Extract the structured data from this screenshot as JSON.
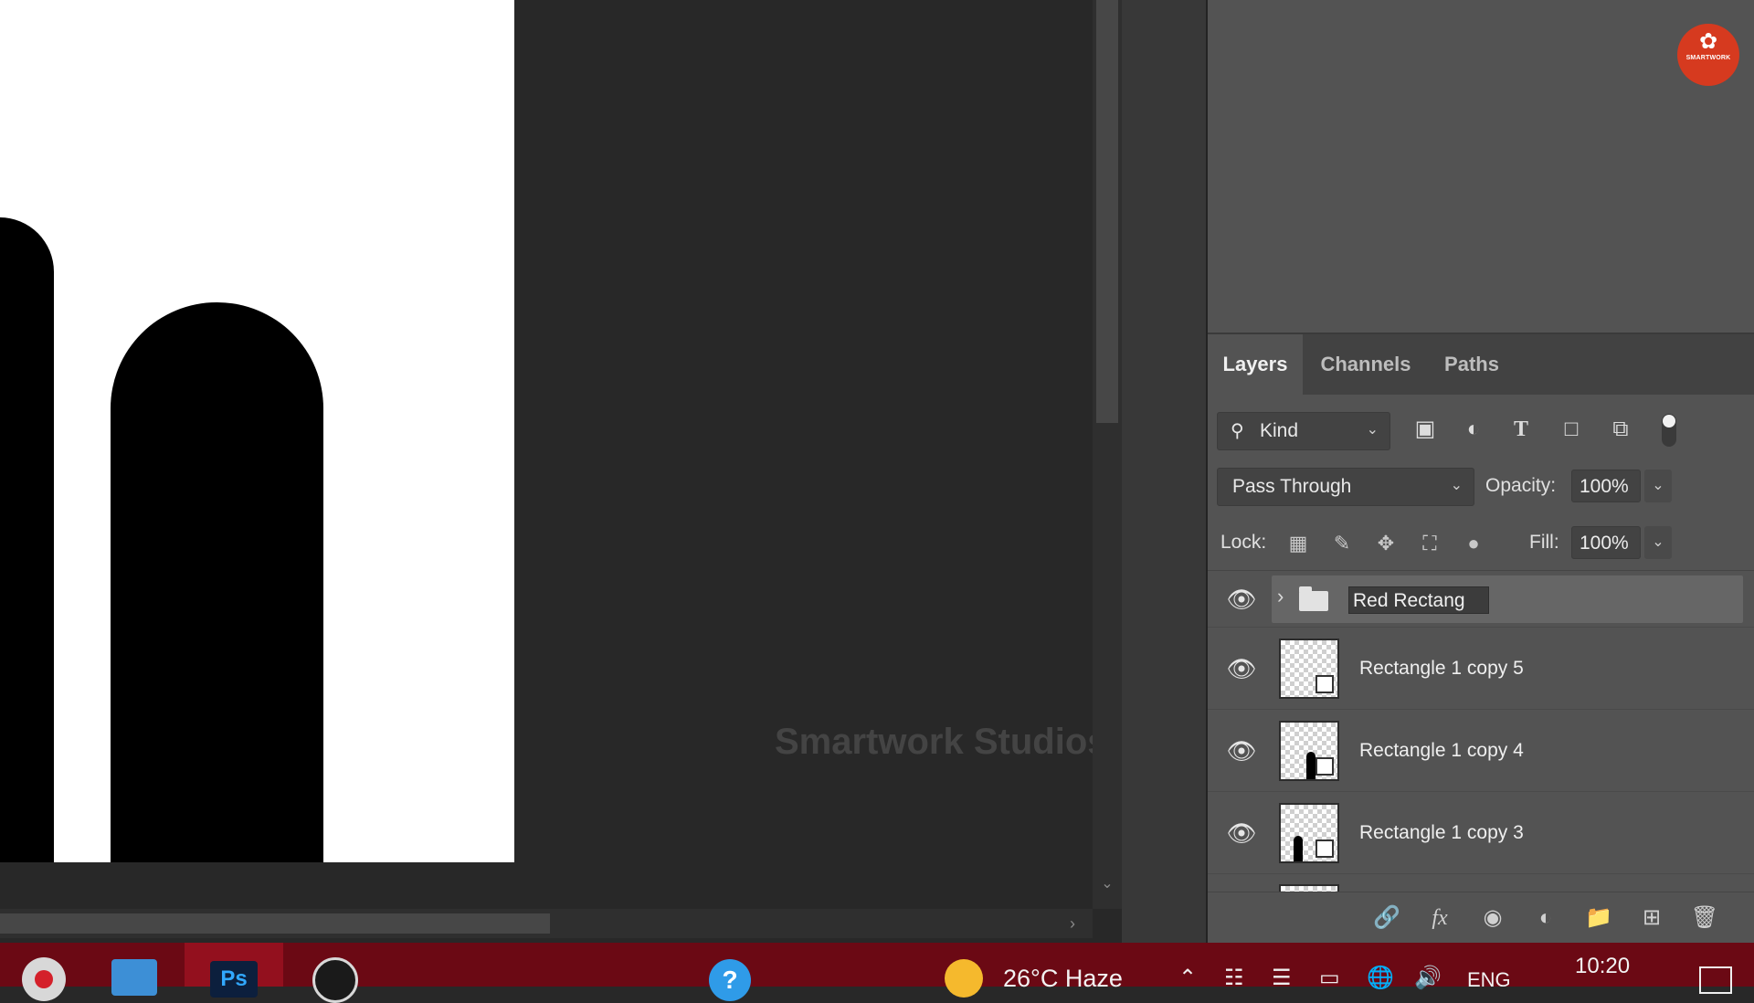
{
  "canvas": {
    "watermark": "Smartwork Studios"
  },
  "logo": {
    "text": "SMARTWORK"
  },
  "panel_tabs": [
    {
      "label": "Layers",
      "active": true
    },
    {
      "label": "Channels",
      "active": false
    },
    {
      "label": "Paths",
      "active": false
    }
  ],
  "filter": {
    "kind_label": "Kind",
    "icons": [
      "image-filter-icon",
      "adjustment-filter-icon",
      "type-filter-icon",
      "shape-filter-icon",
      "smart-object-filter-icon"
    ]
  },
  "blend": {
    "mode": "Pass Through",
    "opacity_label": "Opacity:",
    "opacity_value": "100%",
    "fill_label": "Fill:",
    "fill_value": "100%"
  },
  "lock": {
    "label": "Lock:",
    "icons": [
      "lock-transparent-pixels-icon",
      "lock-image-pixels-icon",
      "lock-position-icon",
      "lock-artboard-icon",
      "lock-all-icon"
    ]
  },
  "layers": {
    "group_name": "Red Rectang",
    "items": [
      {
        "name": "Rectangle 1 copy 5",
        "visible": true
      },
      {
        "name": "Rectangle 1 copy 4",
        "visible": true
      },
      {
        "name": "Rectangle 1 copy 3",
        "visible": true
      }
    ]
  },
  "bottom_toolbar": [
    "link-layers-icon",
    "fx-icon",
    "add-mask-icon",
    "adjustment-layer-icon",
    "new-group-icon",
    "new-layer-icon",
    "delete-icon"
  ],
  "taskbar": {
    "ps_label": "Ps",
    "weather": "26°C  Haze",
    "language": "ENG",
    "time": "10:20"
  },
  "colors": {
    "taskbar": "#6b0914",
    "panel": "#535353",
    "canvas_bg": "#282828",
    "logo": "#d63a1f"
  }
}
